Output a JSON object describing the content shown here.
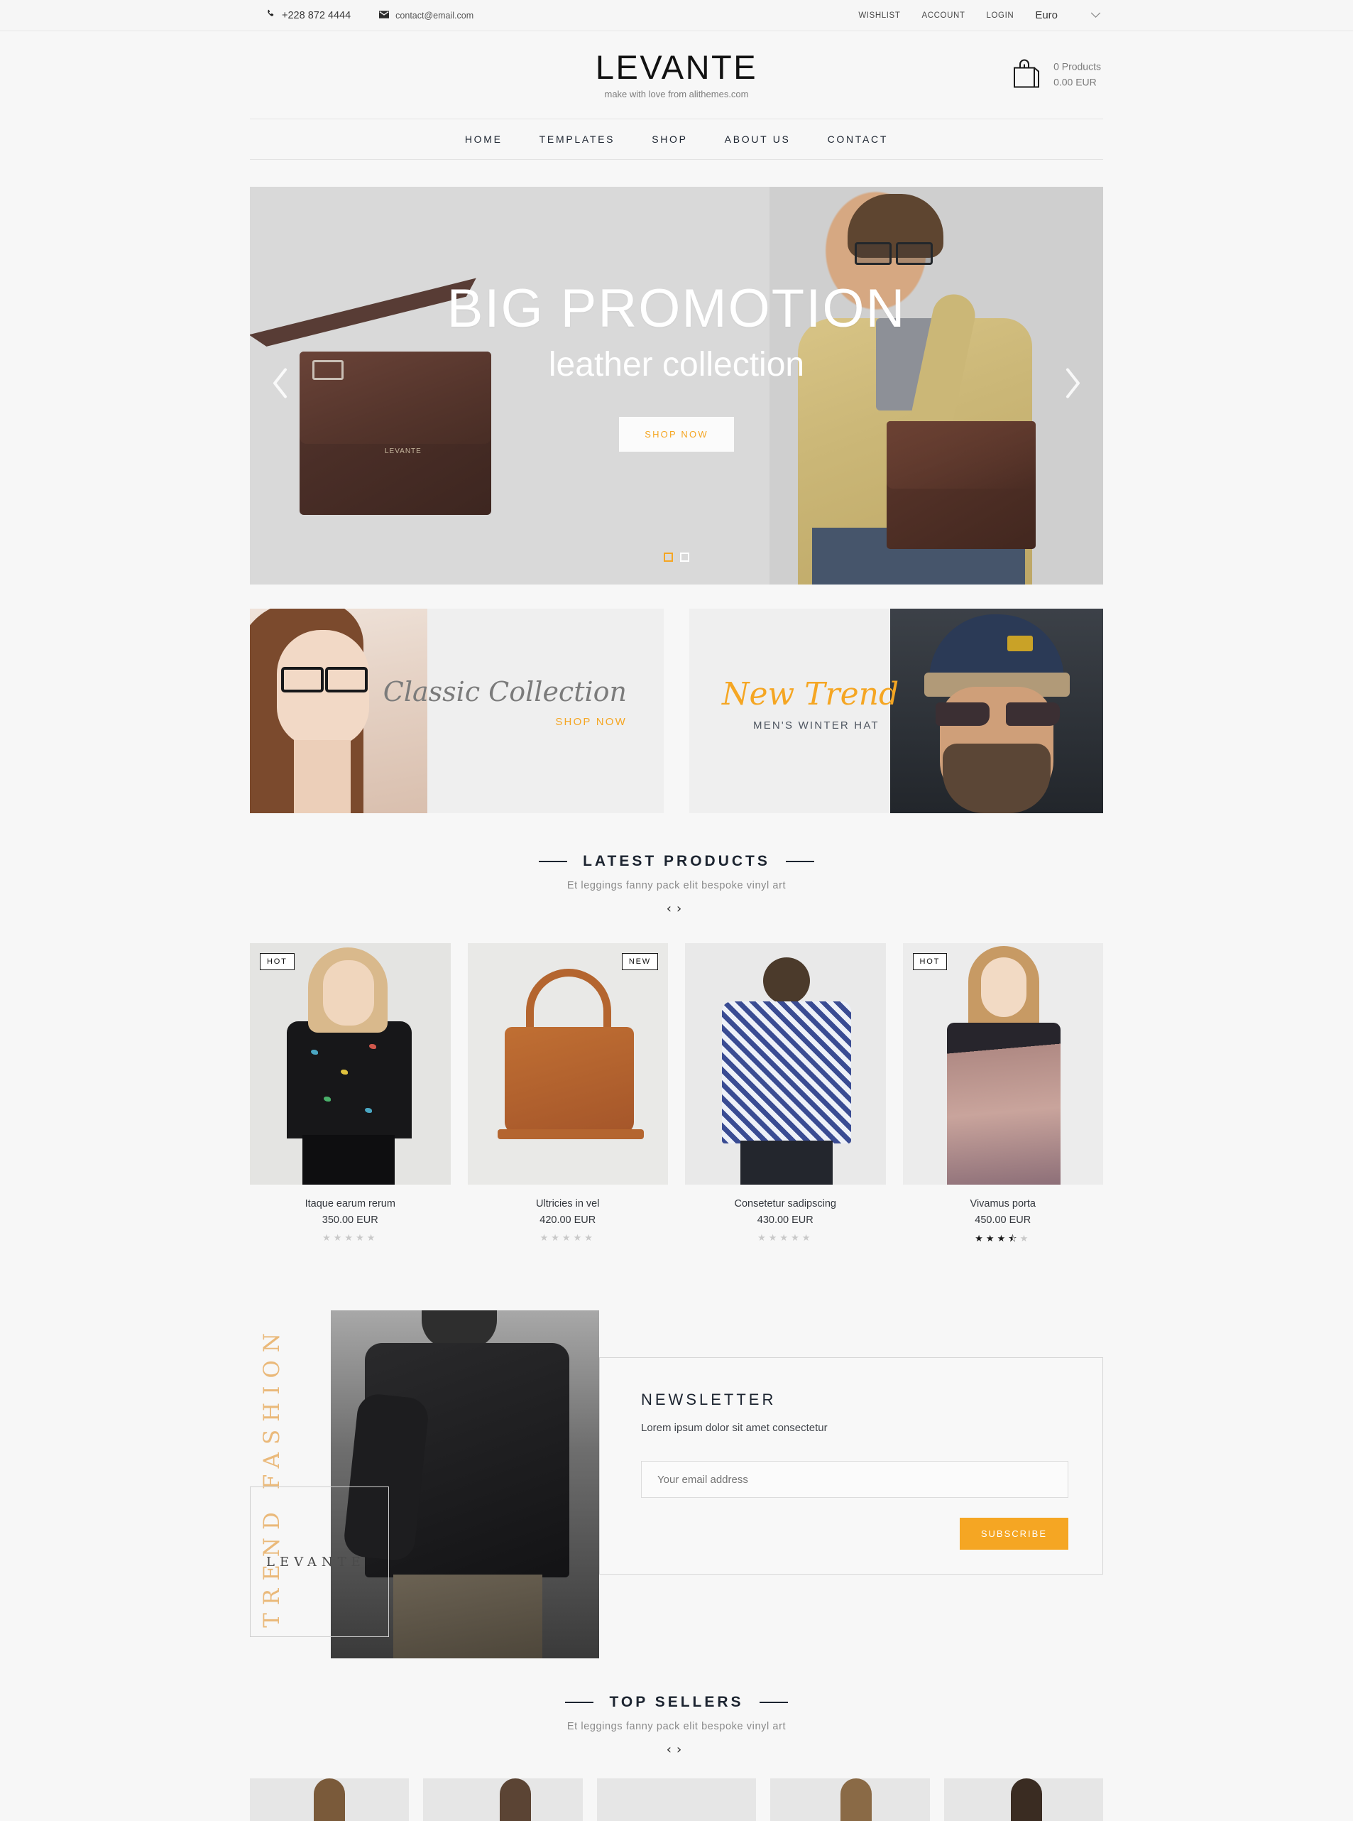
{
  "topbar": {
    "phone": "+228 872 4444",
    "email": "contact@email.com",
    "links": [
      "WISHLIST",
      "ACCOUNT",
      "LOGIN"
    ],
    "currency": "Euro",
    "caret": "⌄"
  },
  "header": {
    "brand": "LEVANTE",
    "tagline": "make with love from alithemes.com",
    "cart": {
      "count_label": "0 Products",
      "total_label": "0.00 EUR"
    }
  },
  "nav": {
    "items": [
      "HOME",
      "TEMPLATES",
      "SHOP",
      "ABOUT US",
      "CONTACT"
    ]
  },
  "hero": {
    "title": "BIG PROMOTION",
    "subtitle": "leather collection",
    "cta": "SHOP NOW",
    "prev": "‹",
    "next": "›",
    "slides": 2,
    "active_slide": 1,
    "accent": "#f5a623"
  },
  "banners": [
    {
      "title": "Classic Collection",
      "cta": "SHOP NOW",
      "title_color": "#7b7b7b",
      "cta_color": "#f5a623"
    },
    {
      "title": "New Trend",
      "subtitle": "MEN'S WINTER HAT",
      "title_color": "#f5a623",
      "subtitle_color": "#4e5560"
    }
  ],
  "latest": {
    "title": "LATEST PRODUCTS",
    "subtitle": "Et leggings fanny pack elit bespoke vinyl art",
    "prev": "‹",
    "next": "›",
    "products": [
      {
        "name": "Itaque earum rerum",
        "price": "350.00 EUR",
        "badge": "HOT",
        "rating": 0
      },
      {
        "name": "Ultricies in vel",
        "price": "420.00 EUR",
        "badge": "NEW",
        "rating": 0
      },
      {
        "name": "Consetetur sadipscing",
        "price": "430.00 EUR",
        "badge": "",
        "rating": 0
      },
      {
        "name": "Vivamus porta",
        "price": "450.00 EUR",
        "badge": "HOT",
        "rating": 3.5
      }
    ]
  },
  "trend": {
    "vertical_text": "TREND FASHION",
    "box_text": "LEVANTE",
    "vertical_color": "#eab97a"
  },
  "newsletter": {
    "title": "NEWSLETTER",
    "subtitle": "Lorem ipsum dolor sit amet consectetur",
    "input_placeholder": "Your email address",
    "input_value": "",
    "button": "SUBSCRIBE",
    "button_color": "#f5a623"
  },
  "topsellers": {
    "title": "TOP SELLERS",
    "subtitle": "Et leggings fanny pack elit bespoke vinyl art",
    "prev": "‹",
    "next": "›"
  }
}
